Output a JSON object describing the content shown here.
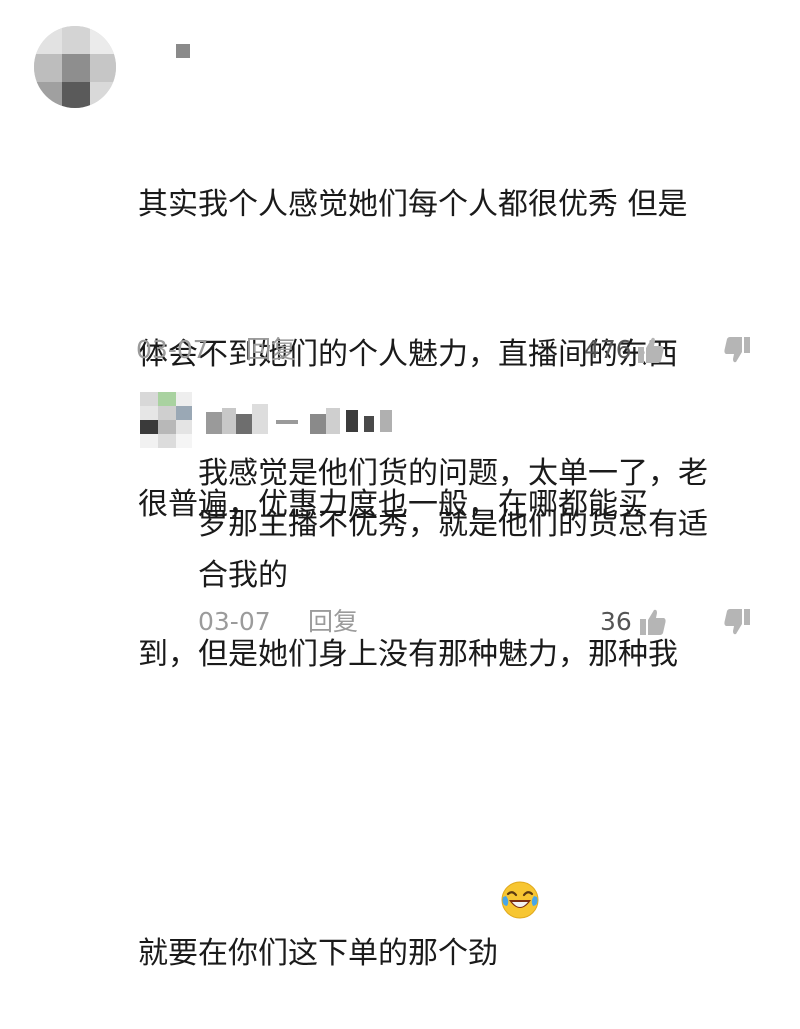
{
  "comment": {
    "text_lines": [
      "其实我个人感觉她们每个人都很优秀 但是",
      "体会不到她们的个人魅力，直播间的东西",
      "很普遍，优惠力度也一般，在哪都能买",
      "到，但是她们身上没有那种魅力，那种我",
      "就要在你们这下单的那个劲"
    ],
    "emoji": "laughing-with-tears-emoji",
    "date": "03-07",
    "reply_label": "回复",
    "likes": "476"
  },
  "reply": {
    "text_lines": [
      "我感觉是他们货的问题，太单一了，老",
      "罗那主播不优秀，就是他们的货总有适",
      "合我的"
    ],
    "date": "03-07",
    "reply_label": "回复",
    "likes": "36"
  },
  "icons": {
    "like": "thumbs-up-icon",
    "dislike": "thumbs-down-icon"
  },
  "colors": {
    "text": "#1a1a1a",
    "meta": "#9b9b9b",
    "like_count": "#555555",
    "icon": "#b5b5b5"
  }
}
